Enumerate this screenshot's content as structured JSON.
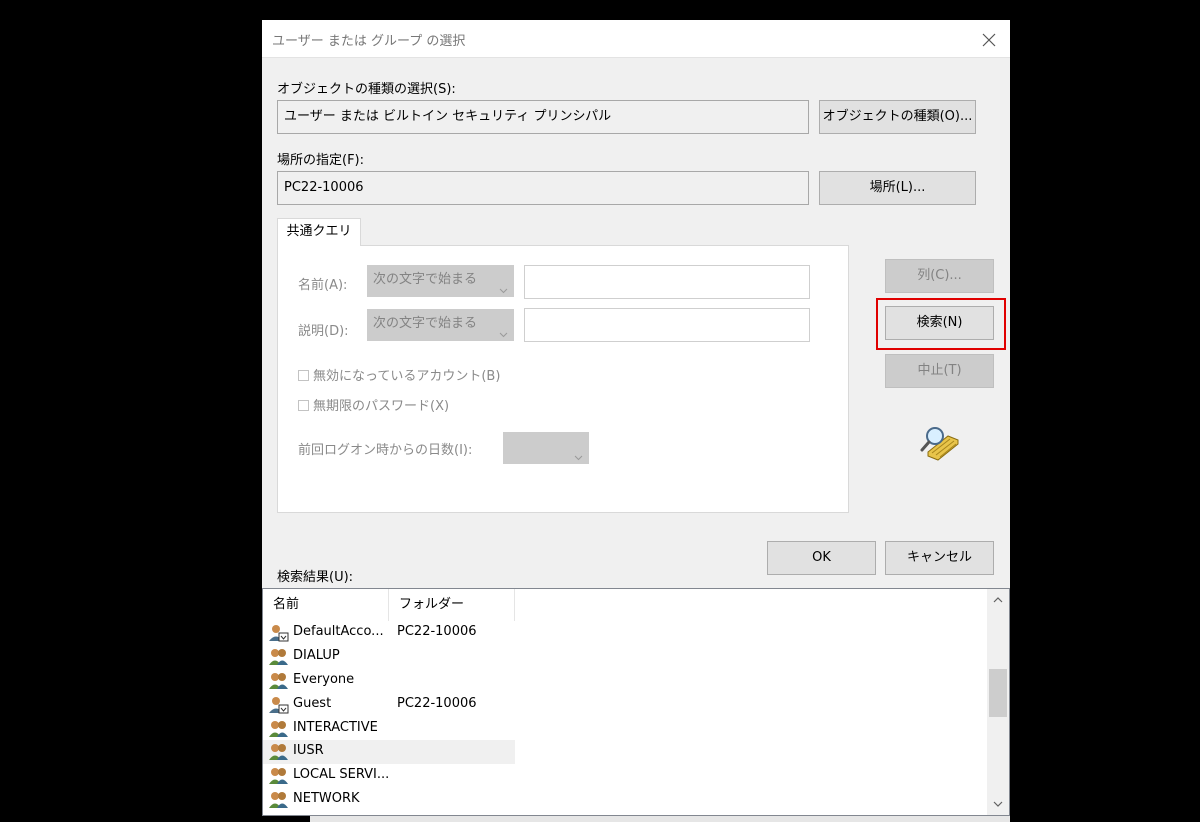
{
  "dialog": {
    "title": "ユーザー または グループ の選択"
  },
  "object_type": {
    "label": "オブジェクトの種類の選択(S):",
    "value": "ユーザー または ビルトイン セキュリティ プリンシパル",
    "button": "オブジェクトの種類(O)..."
  },
  "location": {
    "label": "場所の指定(F):",
    "value": "PC22-10006",
    "button": "場所(L)..."
  },
  "query": {
    "tab_label": "共通クエリ",
    "name_label": "名前(A):",
    "name_mode": "次の文字で始まる",
    "name_value": "",
    "desc_label": "説明(D):",
    "desc_mode": "次の文字で始まる",
    "desc_value": "",
    "disabled_accounts": "無効になっているアカウント(B)",
    "no_expire_pw": "無期限のパスワード(X)",
    "days_since_logon": "前回ログオン時からの日数(I):"
  },
  "side_buttons": {
    "columns": "列(C)...",
    "search": "検索(N)",
    "stop": "中止(T)"
  },
  "footer_buttons": {
    "ok": "OK",
    "cancel": "キャンセル"
  },
  "results": {
    "label": "検索結果(U):",
    "columns": [
      "名前",
      "フォルダー"
    ],
    "rows": [
      {
        "name": "DefaultAcco...",
        "folder": "PC22-10006",
        "icon": "user-icon"
      },
      {
        "name": "DIALUP",
        "folder": "",
        "icon": "group-icon"
      },
      {
        "name": "Everyone",
        "folder": "",
        "icon": "group-icon"
      },
      {
        "name": "Guest",
        "folder": "PC22-10006",
        "icon": "user-icon"
      },
      {
        "name": "INTERACTIVE",
        "folder": "",
        "icon": "group-icon"
      },
      {
        "name": "IUSR",
        "folder": "",
        "icon": "group-icon"
      },
      {
        "name": "LOCAL SERVI...",
        "folder": "",
        "icon": "group-icon"
      },
      {
        "name": "NETWORK",
        "folder": "",
        "icon": "group-icon"
      }
    ]
  },
  "colors": {
    "highlight": "#e00000"
  }
}
